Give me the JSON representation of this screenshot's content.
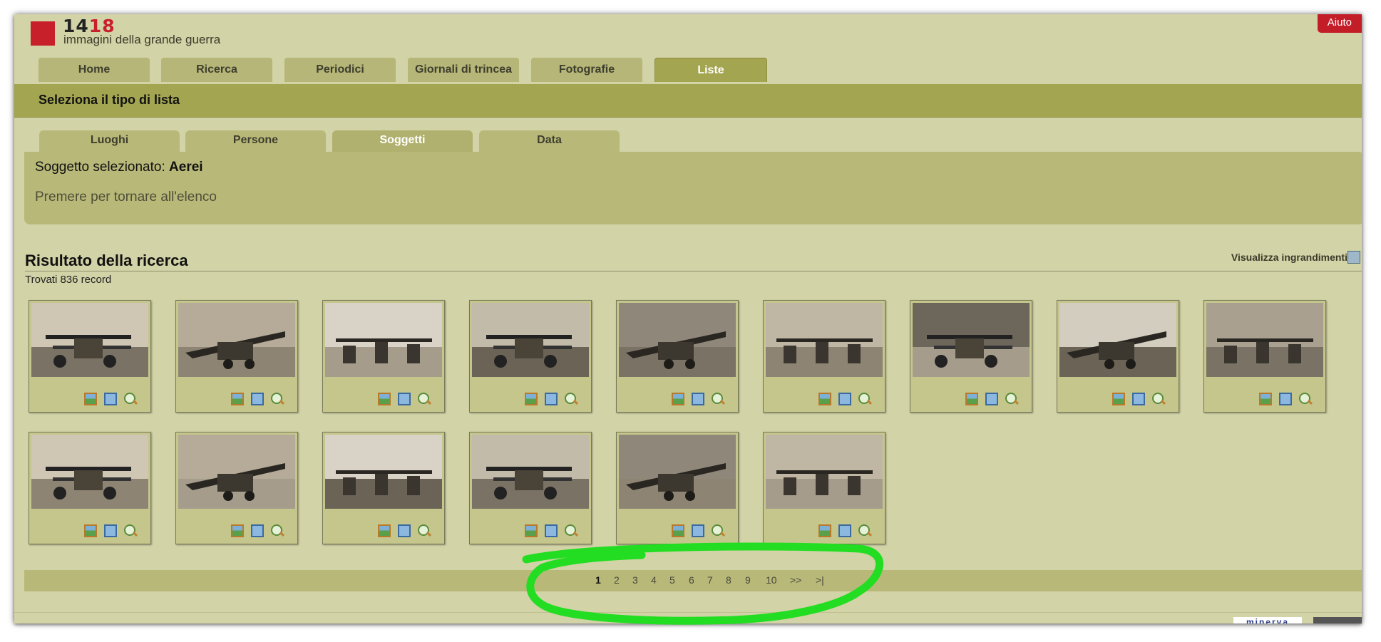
{
  "header": {
    "logo_num_black": "14",
    "logo_num_red": "18",
    "logo_subtitle": "immagini della grande guerra",
    "help_label": "Aiuto"
  },
  "nav": {
    "tabs": [
      {
        "label": "Home",
        "active": false
      },
      {
        "label": "Ricerca",
        "active": false
      },
      {
        "label": "Periodici",
        "active": false
      },
      {
        "label": "Giornali di trincea",
        "active": false
      },
      {
        "label": "Fotografie",
        "active": false
      },
      {
        "label": "Liste",
        "active": true
      }
    ]
  },
  "section_bar": {
    "title": "Seleziona il tipo di lista"
  },
  "list_tabs": [
    {
      "label": "Luoghi",
      "active": false
    },
    {
      "label": "Persone",
      "active": false
    },
    {
      "label": "Soggetti",
      "active": true
    },
    {
      "label": "Data",
      "active": false
    }
  ],
  "selection": {
    "prefix": "Soggetto selezionato:",
    "value": "Aerei",
    "back_link": "Premere per tornare all'elenco"
  },
  "results": {
    "title": "Risultato della ricerca",
    "count": "Trovati 836 record",
    "view_enlargements": "Visualizza ingrandimenti",
    "thumbnails_count": 15
  },
  "pagination": {
    "pages": [
      "1",
      "2",
      "3",
      "4",
      "5",
      "6",
      "7",
      "8",
      "9",
      "10",
      ">>",
      ">|"
    ],
    "current": "1"
  },
  "footer": {
    "logo": "minerva"
  },
  "colors": {
    "page_bg": "#d2d3a6",
    "accent": "#a3a551",
    "tab": "#b5b677",
    "help_red": "#c31d28",
    "logo_red": "#c8202a",
    "highlight_green": "#22dd22"
  }
}
